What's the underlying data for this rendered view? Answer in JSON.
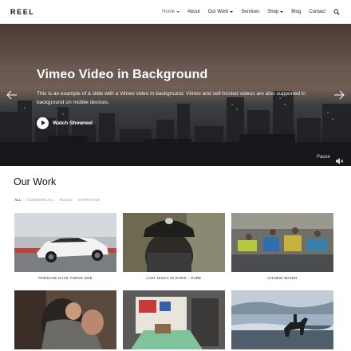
{
  "header": {
    "logo": "REEL",
    "nav": [
      {
        "label": "Home",
        "dropdown": true,
        "active": true
      },
      {
        "label": "About",
        "dropdown": false,
        "active": false
      },
      {
        "label": "Our Work",
        "dropdown": true,
        "active": false
      },
      {
        "label": "Services",
        "dropdown": false,
        "active": false
      },
      {
        "label": "Shop",
        "dropdown": true,
        "active": false
      },
      {
        "label": "Blog",
        "dropdown": false,
        "active": false
      },
      {
        "label": "Contact",
        "dropdown": false,
        "active": false
      }
    ],
    "search_icon": "search-icon"
  },
  "hero": {
    "title": "Vimeo Video in Background",
    "text": "This is an example of a slide with a Vimeo video in background. Vimeo and self-hosted videos are also supported in background on mobile devices.",
    "cta_label": "Watch Showreel",
    "pause_label": "Pause",
    "icons": [
      "chevron-left-icon",
      "chevron-right-icon",
      "play-icon",
      "sound-icon"
    ]
  },
  "work": {
    "title": "Our Work",
    "filters": [
      "ALL",
      "COMMERCIAL",
      "MUSIC",
      "NARRATIVE"
    ],
    "items": [
      {
        "caption": "PORSCHE RACE TORCE ONE"
      },
      {
        "caption": "LAST NIGHT IN PARIS – PURE"
      },
      {
        "caption": "VITAMIN WATER"
      },
      {
        "caption": ""
      },
      {
        "caption": ""
      },
      {
        "caption": ""
      }
    ]
  },
  "colors": {
    "accent": "#111111",
    "muted": "#999999",
    "hero_dark": "#2d2f33"
  }
}
